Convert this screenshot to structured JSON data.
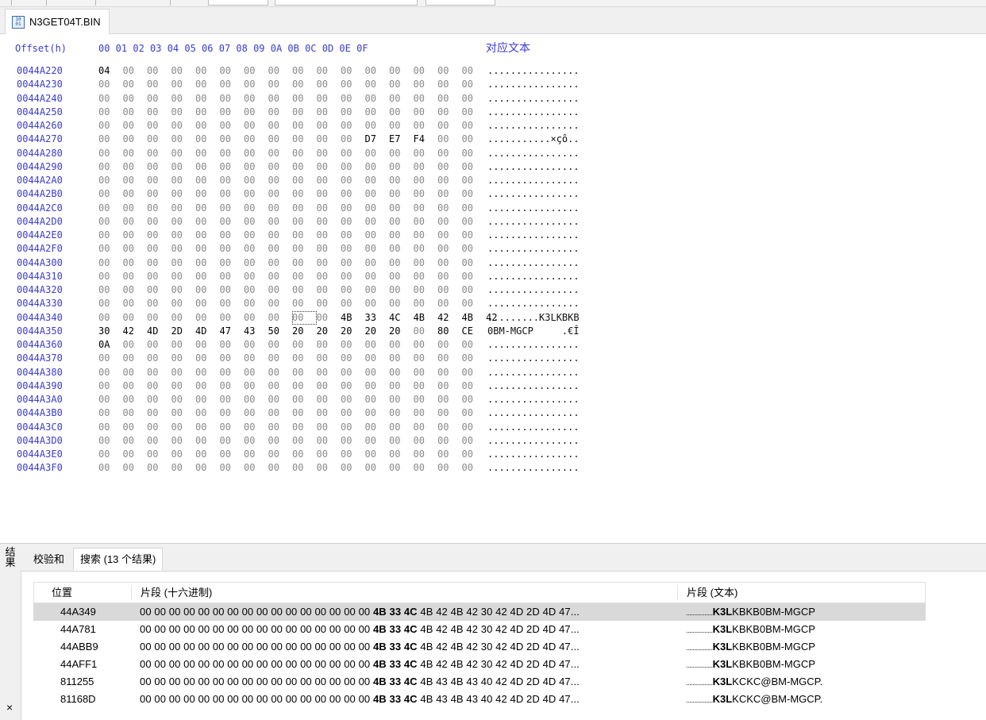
{
  "file_tab": {
    "name": "N3GET04T.BIN"
  },
  "header": {
    "offset_label": "Offset(h)",
    "columns": "00 01 02 03 04 05 06 07 08 09 0A 0B 0C 0D 0E 0F",
    "text_label": "对应文本"
  },
  "rows": [
    {
      "offset": "0044A220",
      "bytes": [
        "04",
        "00",
        "00",
        "00",
        "00",
        "00",
        "00",
        "00",
        "00",
        "00",
        "00",
        "00",
        "00",
        "00",
        "00",
        "00"
      ],
      "text": "................"
    },
    {
      "offset": "0044A230",
      "bytes": [
        "00",
        "00",
        "00",
        "00",
        "00",
        "00",
        "00",
        "00",
        "00",
        "00",
        "00",
        "00",
        "00",
        "00",
        "00",
        "00"
      ],
      "text": "................"
    },
    {
      "offset": "0044A240",
      "bytes": [
        "00",
        "00",
        "00",
        "00",
        "00",
        "00",
        "00",
        "00",
        "00",
        "00",
        "00",
        "00",
        "00",
        "00",
        "00",
        "00"
      ],
      "text": "................"
    },
    {
      "offset": "0044A250",
      "bytes": [
        "00",
        "00",
        "00",
        "00",
        "00",
        "00",
        "00",
        "00",
        "00",
        "00",
        "00",
        "00",
        "00",
        "00",
        "00",
        "00"
      ],
      "text": "................"
    },
    {
      "offset": "0044A260",
      "bytes": [
        "00",
        "00",
        "00",
        "00",
        "00",
        "00",
        "00",
        "00",
        "00",
        "00",
        "00",
        "00",
        "00",
        "00",
        "00",
        "00"
      ],
      "text": "................"
    },
    {
      "offset": "0044A270",
      "bytes": [
        "00",
        "00",
        "00",
        "00",
        "00",
        "00",
        "00",
        "00",
        "00",
        "00",
        "00",
        "D7",
        "E7",
        "F4",
        "00",
        "00"
      ],
      "text": "...........×çô.."
    },
    {
      "offset": "0044A280",
      "bytes": [
        "00",
        "00",
        "00",
        "00",
        "00",
        "00",
        "00",
        "00",
        "00",
        "00",
        "00",
        "00",
        "00",
        "00",
        "00",
        "00"
      ],
      "text": "................"
    },
    {
      "offset": "0044A290",
      "bytes": [
        "00",
        "00",
        "00",
        "00",
        "00",
        "00",
        "00",
        "00",
        "00",
        "00",
        "00",
        "00",
        "00",
        "00",
        "00",
        "00"
      ],
      "text": "................"
    },
    {
      "offset": "0044A2A0",
      "bytes": [
        "00",
        "00",
        "00",
        "00",
        "00",
        "00",
        "00",
        "00",
        "00",
        "00",
        "00",
        "00",
        "00",
        "00",
        "00",
        "00"
      ],
      "text": "................"
    },
    {
      "offset": "0044A2B0",
      "bytes": [
        "00",
        "00",
        "00",
        "00",
        "00",
        "00",
        "00",
        "00",
        "00",
        "00",
        "00",
        "00",
        "00",
        "00",
        "00",
        "00"
      ],
      "text": "................"
    },
    {
      "offset": "0044A2C0",
      "bytes": [
        "00",
        "00",
        "00",
        "00",
        "00",
        "00",
        "00",
        "00",
        "00",
        "00",
        "00",
        "00",
        "00",
        "00",
        "00",
        "00"
      ],
      "text": "................"
    },
    {
      "offset": "0044A2D0",
      "bytes": [
        "00",
        "00",
        "00",
        "00",
        "00",
        "00",
        "00",
        "00",
        "00",
        "00",
        "00",
        "00",
        "00",
        "00",
        "00",
        "00"
      ],
      "text": "................"
    },
    {
      "offset": "0044A2E0",
      "bytes": [
        "00",
        "00",
        "00",
        "00",
        "00",
        "00",
        "00",
        "00",
        "00",
        "00",
        "00",
        "00",
        "00",
        "00",
        "00",
        "00"
      ],
      "text": "................"
    },
    {
      "offset": "0044A2F0",
      "bytes": [
        "00",
        "00",
        "00",
        "00",
        "00",
        "00",
        "00",
        "00",
        "00",
        "00",
        "00",
        "00",
        "00",
        "00",
        "00",
        "00"
      ],
      "text": "................"
    },
    {
      "offset": "0044A300",
      "bytes": [
        "00",
        "00",
        "00",
        "00",
        "00",
        "00",
        "00",
        "00",
        "00",
        "00",
        "00",
        "00",
        "00",
        "00",
        "00",
        "00"
      ],
      "text": "................"
    },
    {
      "offset": "0044A310",
      "bytes": [
        "00",
        "00",
        "00",
        "00",
        "00",
        "00",
        "00",
        "00",
        "00",
        "00",
        "00",
        "00",
        "00",
        "00",
        "00",
        "00"
      ],
      "text": "................"
    },
    {
      "offset": "0044A320",
      "bytes": [
        "00",
        "00",
        "00",
        "00",
        "00",
        "00",
        "00",
        "00",
        "00",
        "00",
        "00",
        "00",
        "00",
        "00",
        "00",
        "00"
      ],
      "text": "................"
    },
    {
      "offset": "0044A330",
      "bytes": [
        "00",
        "00",
        "00",
        "00",
        "00",
        "00",
        "00",
        "00",
        "00",
        "00",
        "00",
        "00",
        "00",
        "00",
        "00",
        "00"
      ],
      "text": "................"
    },
    {
      "offset": "0044A340",
      "bytes": [
        "00",
        "00",
        "00",
        "00",
        "00",
        "00",
        "00",
        "00",
        "00",
        "00",
        "4B",
        "33",
        "4C",
        "4B",
        "42",
        "4B",
        "42"
      ],
      "text": ".........K3LKBKB"
    },
    {
      "offset": "0044A350",
      "bytes": [
        "30",
        "42",
        "4D",
        "2D",
        "4D",
        "47",
        "43",
        "50",
        "20",
        "20",
        "20",
        "20",
        "20",
        "00",
        "80",
        "CE"
      ],
      "text": "0BM-MGCP     .€Î"
    },
    {
      "offset": "0044A360",
      "bytes": [
        "0A",
        "00",
        "00",
        "00",
        "00",
        "00",
        "00",
        "00",
        "00",
        "00",
        "00",
        "00",
        "00",
        "00",
        "00",
        "00"
      ],
      "text": "................"
    },
    {
      "offset": "0044A370",
      "bytes": [
        "00",
        "00",
        "00",
        "00",
        "00",
        "00",
        "00",
        "00",
        "00",
        "00",
        "00",
        "00",
        "00",
        "00",
        "00",
        "00"
      ],
      "text": "................"
    },
    {
      "offset": "0044A380",
      "bytes": [
        "00",
        "00",
        "00",
        "00",
        "00",
        "00",
        "00",
        "00",
        "00",
        "00",
        "00",
        "00",
        "00",
        "00",
        "00",
        "00"
      ],
      "text": "................"
    },
    {
      "offset": "0044A390",
      "bytes": [
        "00",
        "00",
        "00",
        "00",
        "00",
        "00",
        "00",
        "00",
        "00",
        "00",
        "00",
        "00",
        "00",
        "00",
        "00",
        "00"
      ],
      "text": "................"
    },
    {
      "offset": "0044A3A0",
      "bytes": [
        "00",
        "00",
        "00",
        "00",
        "00",
        "00",
        "00",
        "00",
        "00",
        "00",
        "00",
        "00",
        "00",
        "00",
        "00",
        "00"
      ],
      "text": "................"
    },
    {
      "offset": "0044A3B0",
      "bytes": [
        "00",
        "00",
        "00",
        "00",
        "00",
        "00",
        "00",
        "00",
        "00",
        "00",
        "00",
        "00",
        "00",
        "00",
        "00",
        "00"
      ],
      "text": "................"
    },
    {
      "offset": "0044A3C0",
      "bytes": [
        "00",
        "00",
        "00",
        "00",
        "00",
        "00",
        "00",
        "00",
        "00",
        "00",
        "00",
        "00",
        "00",
        "00",
        "00",
        "00"
      ],
      "text": "................"
    },
    {
      "offset": "0044A3D0",
      "bytes": [
        "00",
        "00",
        "00",
        "00",
        "00",
        "00",
        "00",
        "00",
        "00",
        "00",
        "00",
        "00",
        "00",
        "00",
        "00",
        "00"
      ],
      "text": "................"
    },
    {
      "offset": "0044A3E0",
      "bytes": [
        "00",
        "00",
        "00",
        "00",
        "00",
        "00",
        "00",
        "00",
        "00",
        "00",
        "00",
        "00",
        "00",
        "00",
        "00",
        "00"
      ],
      "text": "................"
    },
    {
      "offset": "0044A3F0",
      "bytes": [
        "00",
        "00",
        "00",
        "00",
        "00",
        "00",
        "00",
        "00",
        "00",
        "00",
        "00",
        "00",
        "00",
        "00",
        "00",
        "00"
      ],
      "text": "................"
    }
  ],
  "cursor": {
    "row_offset": "0044A340",
    "byte_index": 8
  },
  "results_panel": {
    "side_label": "结果",
    "close_icon": "×",
    "tabs": [
      {
        "label": "校验和",
        "active": false
      },
      {
        "label": "搜索 (13 个结果)",
        "active": true
      }
    ],
    "columns": {
      "position": "位置",
      "hex": "片段 (十六进制)",
      "text": "片段 (文本)"
    },
    "results": [
      {
        "position": "44A349",
        "hex_pre": "00 00 00 00 00 00 00 00 00 00 00 00 00 00 00 00 ",
        "hex_match": "4B 33 4C",
        "hex_post": " 4B 42 4B 42 30 42 4D 2D 4D 47...",
        "text_pre": "................",
        "text_match": "K3L",
        "text_post": "KBKB0BM-MGCP",
        "selected": true
      },
      {
        "position": "44A781",
        "hex_pre": "00 00 00 00 00 00 00 00 00 00 00 00 00 00 00 00 ",
        "hex_match": "4B 33 4C",
        "hex_post": " 4B 42 4B 42 30 42 4D 2D 4D 47...",
        "text_pre": "................",
        "text_match": "K3L",
        "text_post": "KBKB0BM-MGCP",
        "selected": false
      },
      {
        "position": "44ABB9",
        "hex_pre": "00 00 00 00 00 00 00 00 00 00 00 00 00 00 00 00 ",
        "hex_match": "4B 33 4C",
        "hex_post": " 4B 42 4B 42 30 42 4D 2D 4D 47...",
        "text_pre": "................",
        "text_match": "K3L",
        "text_post": "KBKB0BM-MGCP",
        "selected": false
      },
      {
        "position": "44AFF1",
        "hex_pre": "00 00 00 00 00 00 00 00 00 00 00 00 00 00 00 00 ",
        "hex_match": "4B 33 4C",
        "hex_post": " 4B 42 4B 42 30 42 4D 2D 4D 47...",
        "text_pre": "................",
        "text_match": "K3L",
        "text_post": "KBKB0BM-MGCP",
        "selected": false
      },
      {
        "position": "811255",
        "hex_pre": "00 00 00 00 00 00 00 00 00 00 00 00 00 00 00 00 ",
        "hex_match": "4B 33 4C",
        "hex_post": " 4B 43 4B 43 40 42 4D 2D 4D 47...",
        "text_pre": "................",
        "text_match": "K3L",
        "text_post": "KCKC@BM-MGCP.",
        "selected": false
      },
      {
        "position": "81168D",
        "hex_pre": "00 00 00 00 00 00 00 00 00 00 00 00 00 00 00 00 ",
        "hex_match": "4B 33 4C",
        "hex_post": " 4B 43 4B 43 40 42 4D 2D 4D 47...",
        "text_pre": "................",
        "text_match": "K3L",
        "text_post": "KCKC@BM-MGCP.",
        "selected": false
      }
    ]
  }
}
